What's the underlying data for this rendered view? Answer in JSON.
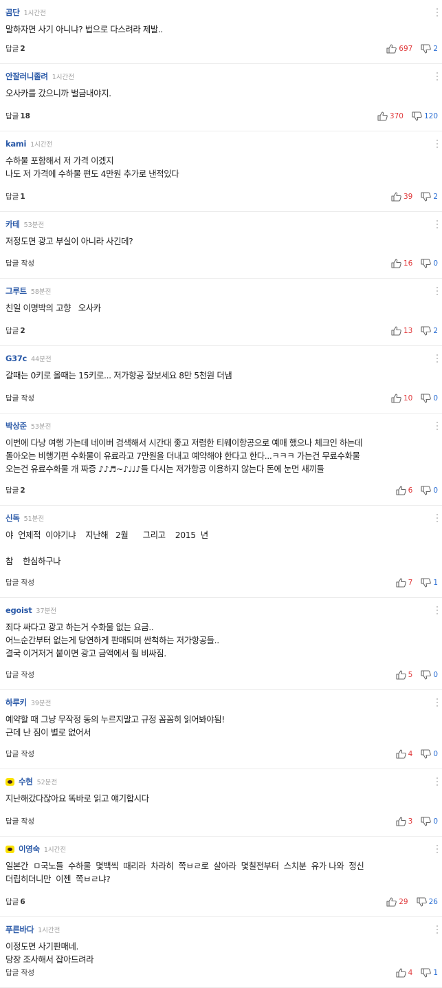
{
  "comments": [
    {
      "author": "곰단",
      "time": "1시간전",
      "kakao": false,
      "lines": [
        "말하자면 사기 아니냐? 법으로 다스려라 제발.."
      ],
      "reply_label": "답글",
      "reply_count": "2",
      "likes": "697",
      "dislikes": "2",
      "h": 93
    },
    {
      "author": "안잘러니졸려",
      "time": "1시간전",
      "kakao": false,
      "lines": [
        "오사카를 갔으니까 벌금내야지."
      ],
      "reply_label": "답글",
      "reply_count": "18",
      "likes": "370",
      "dislikes": "120",
      "h": 98
    },
    {
      "author": "kami",
      "time": "1시간전",
      "kakao": false,
      "lines": [
        "수하물 포함해서 저 가격 이겠지",
        "나도 저 가격에 수하물 편도 4만원 추가로 낸적있다"
      ],
      "reply_label": "답글",
      "reply_count": "1",
      "likes": "39",
      "dislikes": "2",
      "h": 117
    },
    {
      "author": "카테",
      "time": "53분전",
      "kakao": false,
      "lines": [
        "저정도면 광고 부실이 아니라 사긴데?"
      ],
      "reply_label": "답글 작성",
      "reply_count": "",
      "likes": "16",
      "dislikes": "0",
      "h": 97
    },
    {
      "author": "그루트",
      "time": "58분전",
      "kakao": false,
      "lines": [
        "친일 이명박의 고향   오사카"
      ],
      "reply_label": "답글",
      "reply_count": "2",
      "likes": "13",
      "dislikes": "2",
      "h": 98
    },
    {
      "author": "G37c",
      "time": "44분전",
      "kakao": false,
      "lines": [
        "갈때는 0키로 올때는 15키로... 저가항공 잘보세요 8만 5천원 더냄"
      ],
      "reply_label": "답글 작성",
      "reply_count": "",
      "likes": "10",
      "dislikes": "0",
      "h": 98
    },
    {
      "author": "박상준",
      "time": "53분전",
      "kakao": false,
      "lines": [
        "이번에 다낭 여행 가는데 네이버 검색해서 시간대 좋고 저렴한 티웨이항공으로 예매 했으나 체크인 하는데",
        "돌아오는 비행기편 수화물이 유료라고 7만원을 더내고 예약해야 한다고 한다...ㅋㅋㅋ 가는건 무료수화물",
        "오는건 유료수화물 개 짜증 ♪♪♬~♪♩♩♪들 다시는 저가항공 이용하지 않는다 돈에 눈먼 새끼들"
      ],
      "reply_label": "답글",
      "reply_count": "2",
      "likes": "6",
      "dislikes": "0",
      "h": 134
    },
    {
      "author": "신독",
      "time": "51분전",
      "kakao": false,
      "lines": [
        "야  언제적  이야기냐    지난해   2월      그리고    2015  년",
        "",
        "참    한심하구나"
      ],
      "reply_label": "답글 작성",
      "reply_count": "",
      "likes": "7",
      "dislikes": "1",
      "h": 134
    },
    {
      "author": "egoist",
      "time": "37분전",
      "kakao": false,
      "lines": [
        "죄다 싸다고 광고 하는거 수화물 없는 요금..",
        "어느순간부터 없는게 당연하게 판매되며 싼척하는 저가항공들..",
        "결국 이거저거 붙이면 광고 금액에서 훨 비싸짐."
      ],
      "reply_label": "답글 작성",
      "reply_count": "",
      "likes": "5",
      "dislikes": "0",
      "h": 134
    },
    {
      "author": "하루키",
      "time": "39분전",
      "kakao": false,
      "lines": [
        "예약할 때 그냥 무작정 동의 누르지말고 규정 꼼꼼히 읽어봐야됨!",
        "근데 난 짐이 별로 없어서"
      ],
      "reply_label": "답글 작성",
      "reply_count": "",
      "likes": "4",
      "dislikes": "0",
      "h": 115
    },
    {
      "author": "수현",
      "time": "52분전",
      "kakao": true,
      "lines": [
        "지난해갔다잖아요 똑바로 읽고 얘기합시다"
      ],
      "reply_label": "답글 작성",
      "reply_count": "",
      "likes": "3",
      "dislikes": "0",
      "h": 98
    },
    {
      "author": "이영숙",
      "time": "1시간전",
      "kakao": true,
      "lines": [
        "일본간  ㅁ국노들  수하물  몇백씩  때리라  차라히  쪽ㅂㄹ로  살아라  몇칠전부터  스치분  유가 나와  정신",
        "더립히더니만  이젠  쪽ㅂㄹ냐?"
      ],
      "reply_label": "답글",
      "reply_count": "6",
      "likes": "29",
      "dislikes": "26",
      "h": 117
    },
    {
      "author": "푸른바다",
      "time": "1시간전",
      "kakao": false,
      "lines": [
        "이정도면 사기판매네.",
        "당장 조사해서 잡아드려라"
      ],
      "reply_label": "답글 작성",
      "reply_count": "",
      "likes": "4",
      "dislikes": "1",
      "h": 103
    }
  ]
}
